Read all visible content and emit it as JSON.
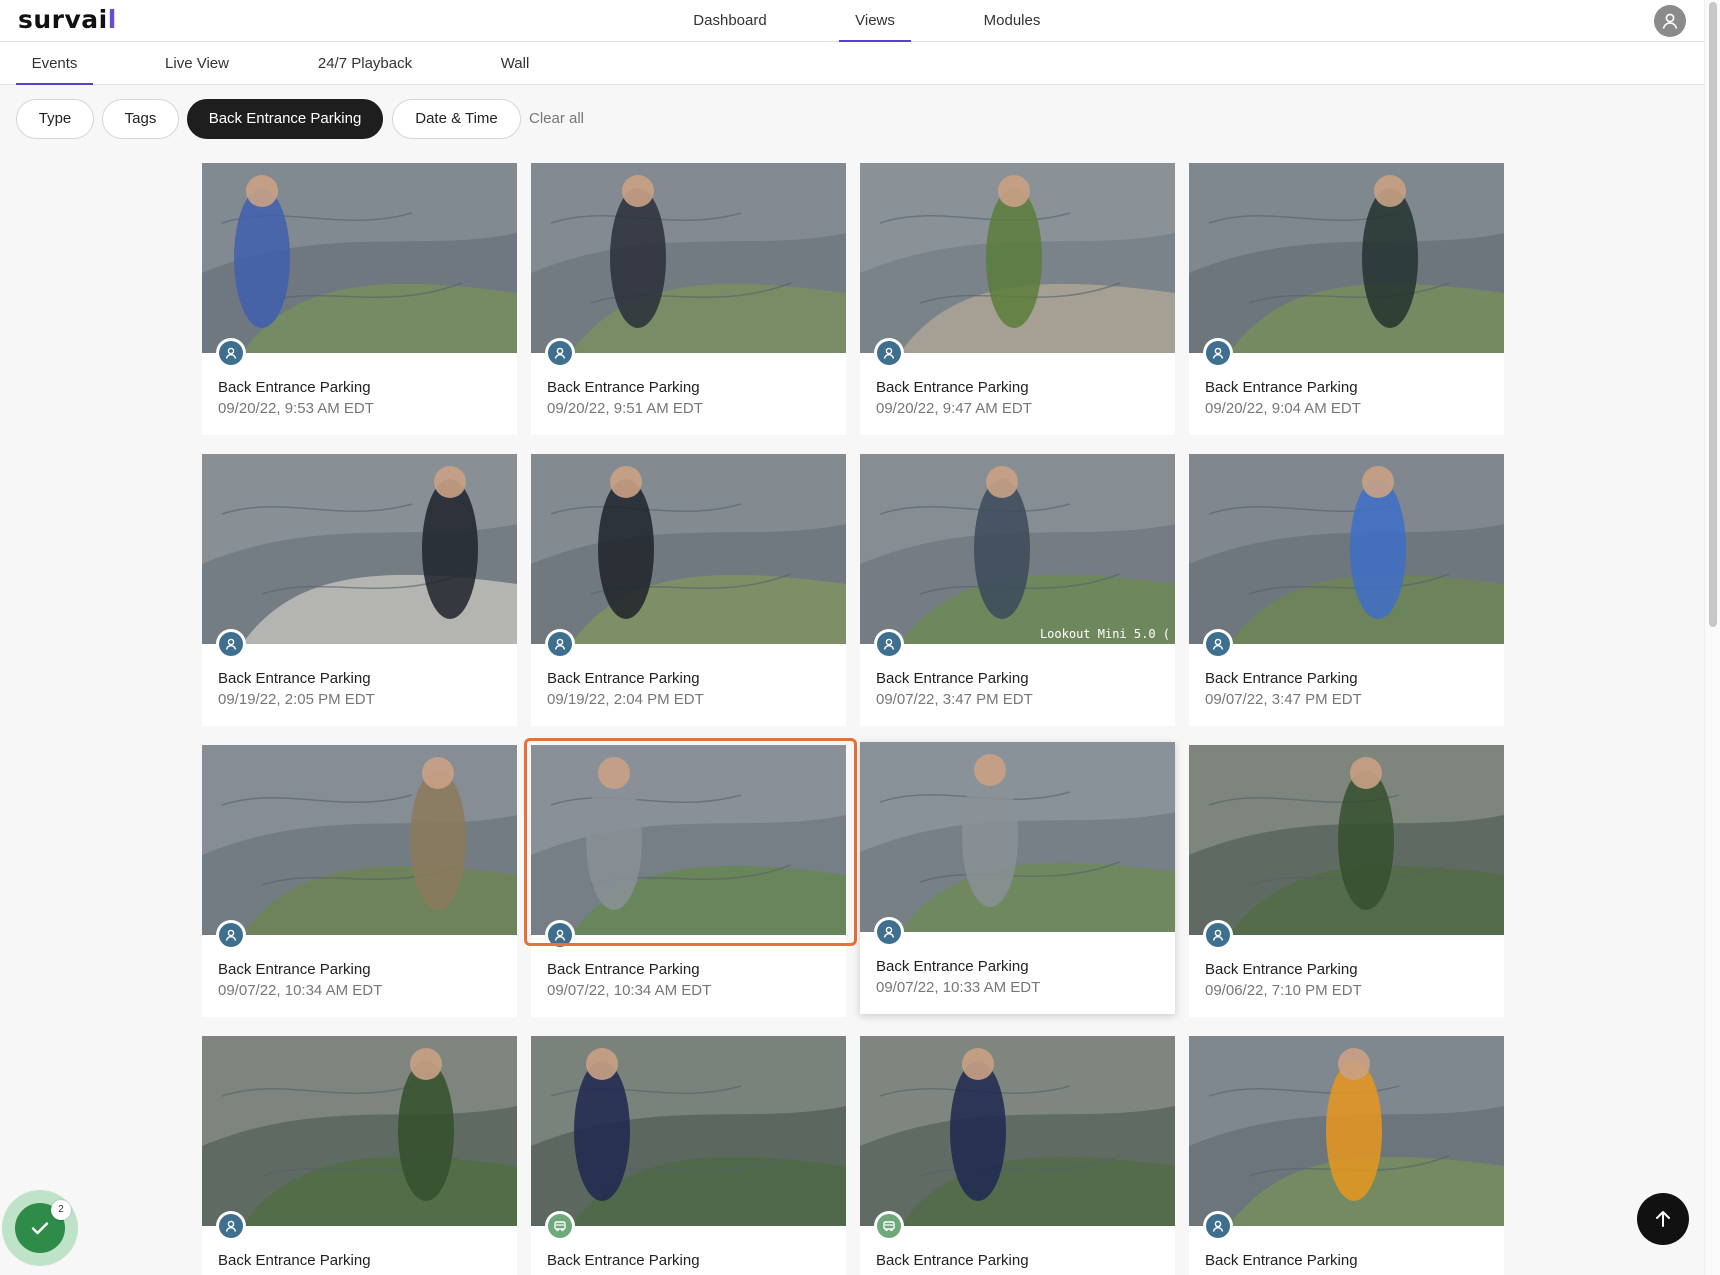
{
  "app": {
    "logo_main": "survai",
    "logo_accent": "l"
  },
  "topnav": {
    "items": [
      {
        "label": "Dashboard"
      },
      {
        "label": "Views"
      },
      {
        "label": "Modules"
      }
    ],
    "active": "Views"
  },
  "subtabs": {
    "items": [
      {
        "label": "Events"
      },
      {
        "label": "Live View"
      },
      {
        "label": "24/7 Playback"
      },
      {
        "label": "Wall"
      }
    ],
    "active": "Events"
  },
  "filters": {
    "chips": [
      {
        "label": "Type"
      },
      {
        "label": "Tags"
      },
      {
        "label": "Back Entrance Parking"
      },
      {
        "label": "Date & Time"
      }
    ],
    "active_chip": "Back Entrance Parking",
    "clear_label": "Clear all"
  },
  "events": [
    {
      "title": "Back Entrance Parking",
      "time": "09/20/22, 9:53 AM EDT",
      "type": "person-icon"
    },
    {
      "title": "Back Entrance Parking",
      "time": "09/20/22, 9:51 AM EDT",
      "type": "person-icon"
    },
    {
      "title": "Back Entrance Parking",
      "time": "09/20/22, 9:47 AM EDT",
      "type": "person-icon"
    },
    {
      "title": "Back Entrance Parking",
      "time": "09/20/22, 9:04 AM EDT",
      "type": "person-icon"
    },
    {
      "title": "Back Entrance Parking",
      "time": "09/19/22, 2:05 PM EDT",
      "type": "person-icon"
    },
    {
      "title": "Back Entrance Parking",
      "time": "09/19/22, 2:04 PM EDT",
      "type": "person-icon"
    },
    {
      "title": "Back Entrance Parking",
      "time": "09/07/22, 3:47 PM EDT",
      "type": "person-icon",
      "overlay_text": "Lookout Mini 5.0 ("
    },
    {
      "title": "Back Entrance Parking",
      "time": "09/07/22, 3:47 PM EDT",
      "type": "person-icon"
    },
    {
      "title": "Back Entrance Parking",
      "time": "09/07/22, 10:34 AM EDT",
      "type": "person-icon"
    },
    {
      "title": "Back Entrance Parking",
      "time": "09/07/22, 10:34 AM EDT",
      "type": "person-icon",
      "selected": true
    },
    {
      "title": "Back Entrance Parking",
      "time": "09/07/22, 10:33 AM EDT",
      "type": "person-icon",
      "hovered": true
    },
    {
      "title": "Back Entrance Parking",
      "time": "09/06/22, 7:10 PM EDT",
      "type": "person-icon"
    },
    {
      "title": "Back Entrance Parking",
      "time": "",
      "type": "person-icon"
    },
    {
      "title": "Back Entrance Parking",
      "time": "",
      "type": "vehicle-icon"
    },
    {
      "title": "Back Entrance Parking",
      "time": "",
      "type": "vehicle-icon"
    },
    {
      "title": "Back Entrance Parking",
      "time": "",
      "type": "person-icon"
    }
  ],
  "status": {
    "count": "2"
  },
  "colors": {
    "accent": "#5b3fd0",
    "selected_outline": "#e8703a",
    "person_badge": "#3f6f8f",
    "vehicle_badge": "#6ea97a",
    "status_green": "#2e8b48"
  }
}
